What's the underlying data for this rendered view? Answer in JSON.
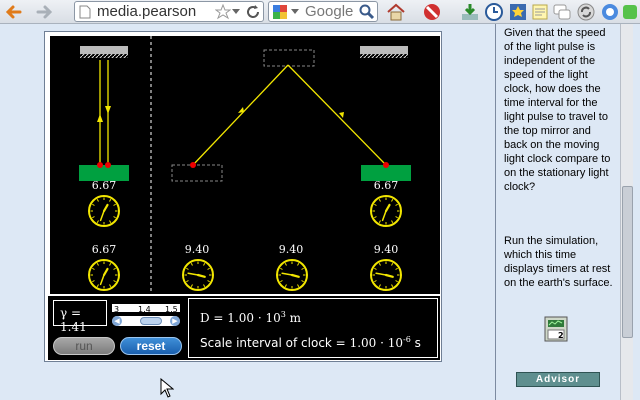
{
  "browser": {
    "url_text": "media.pearson",
    "search_placeholder": "Google"
  },
  "simulation": {
    "timers_top": [
      "6.67",
      "6.67"
    ],
    "timers_bottom": [
      "6.67",
      "9.40",
      "9.40",
      "9.40"
    ],
    "gamma_label": "γ = 1.41",
    "slider_ticks": [
      "3",
      "1.4",
      "1.5"
    ],
    "run_label": "run",
    "reset_label": "reset",
    "distance_prefix": "D = 1.00 · 10",
    "distance_exponent": "3",
    "distance_unit": " m",
    "scale_prefix": "Scale interval of clock = ",
    "scale_value": "1.00 · 10",
    "scale_exponent": "-6",
    "scale_unit": "  s"
  },
  "sidebar": {
    "question": "Given that the speed of the light pulse is independent of the speed of the light clock, how does the time interval for the light pulse to travel to the top mirror and back on the moving light clock compare to on the stationary light clock?",
    "instruction": "Run the simulation, which this time displays timers at rest on the earth's surface.",
    "advisor_label": "Advisor"
  },
  "colors": {
    "mirror_green": "#00a040",
    "light_yellow": "#f2e600",
    "reset_blue": "#2a6fc0",
    "advisor_teal": "#5f8f8f"
  }
}
